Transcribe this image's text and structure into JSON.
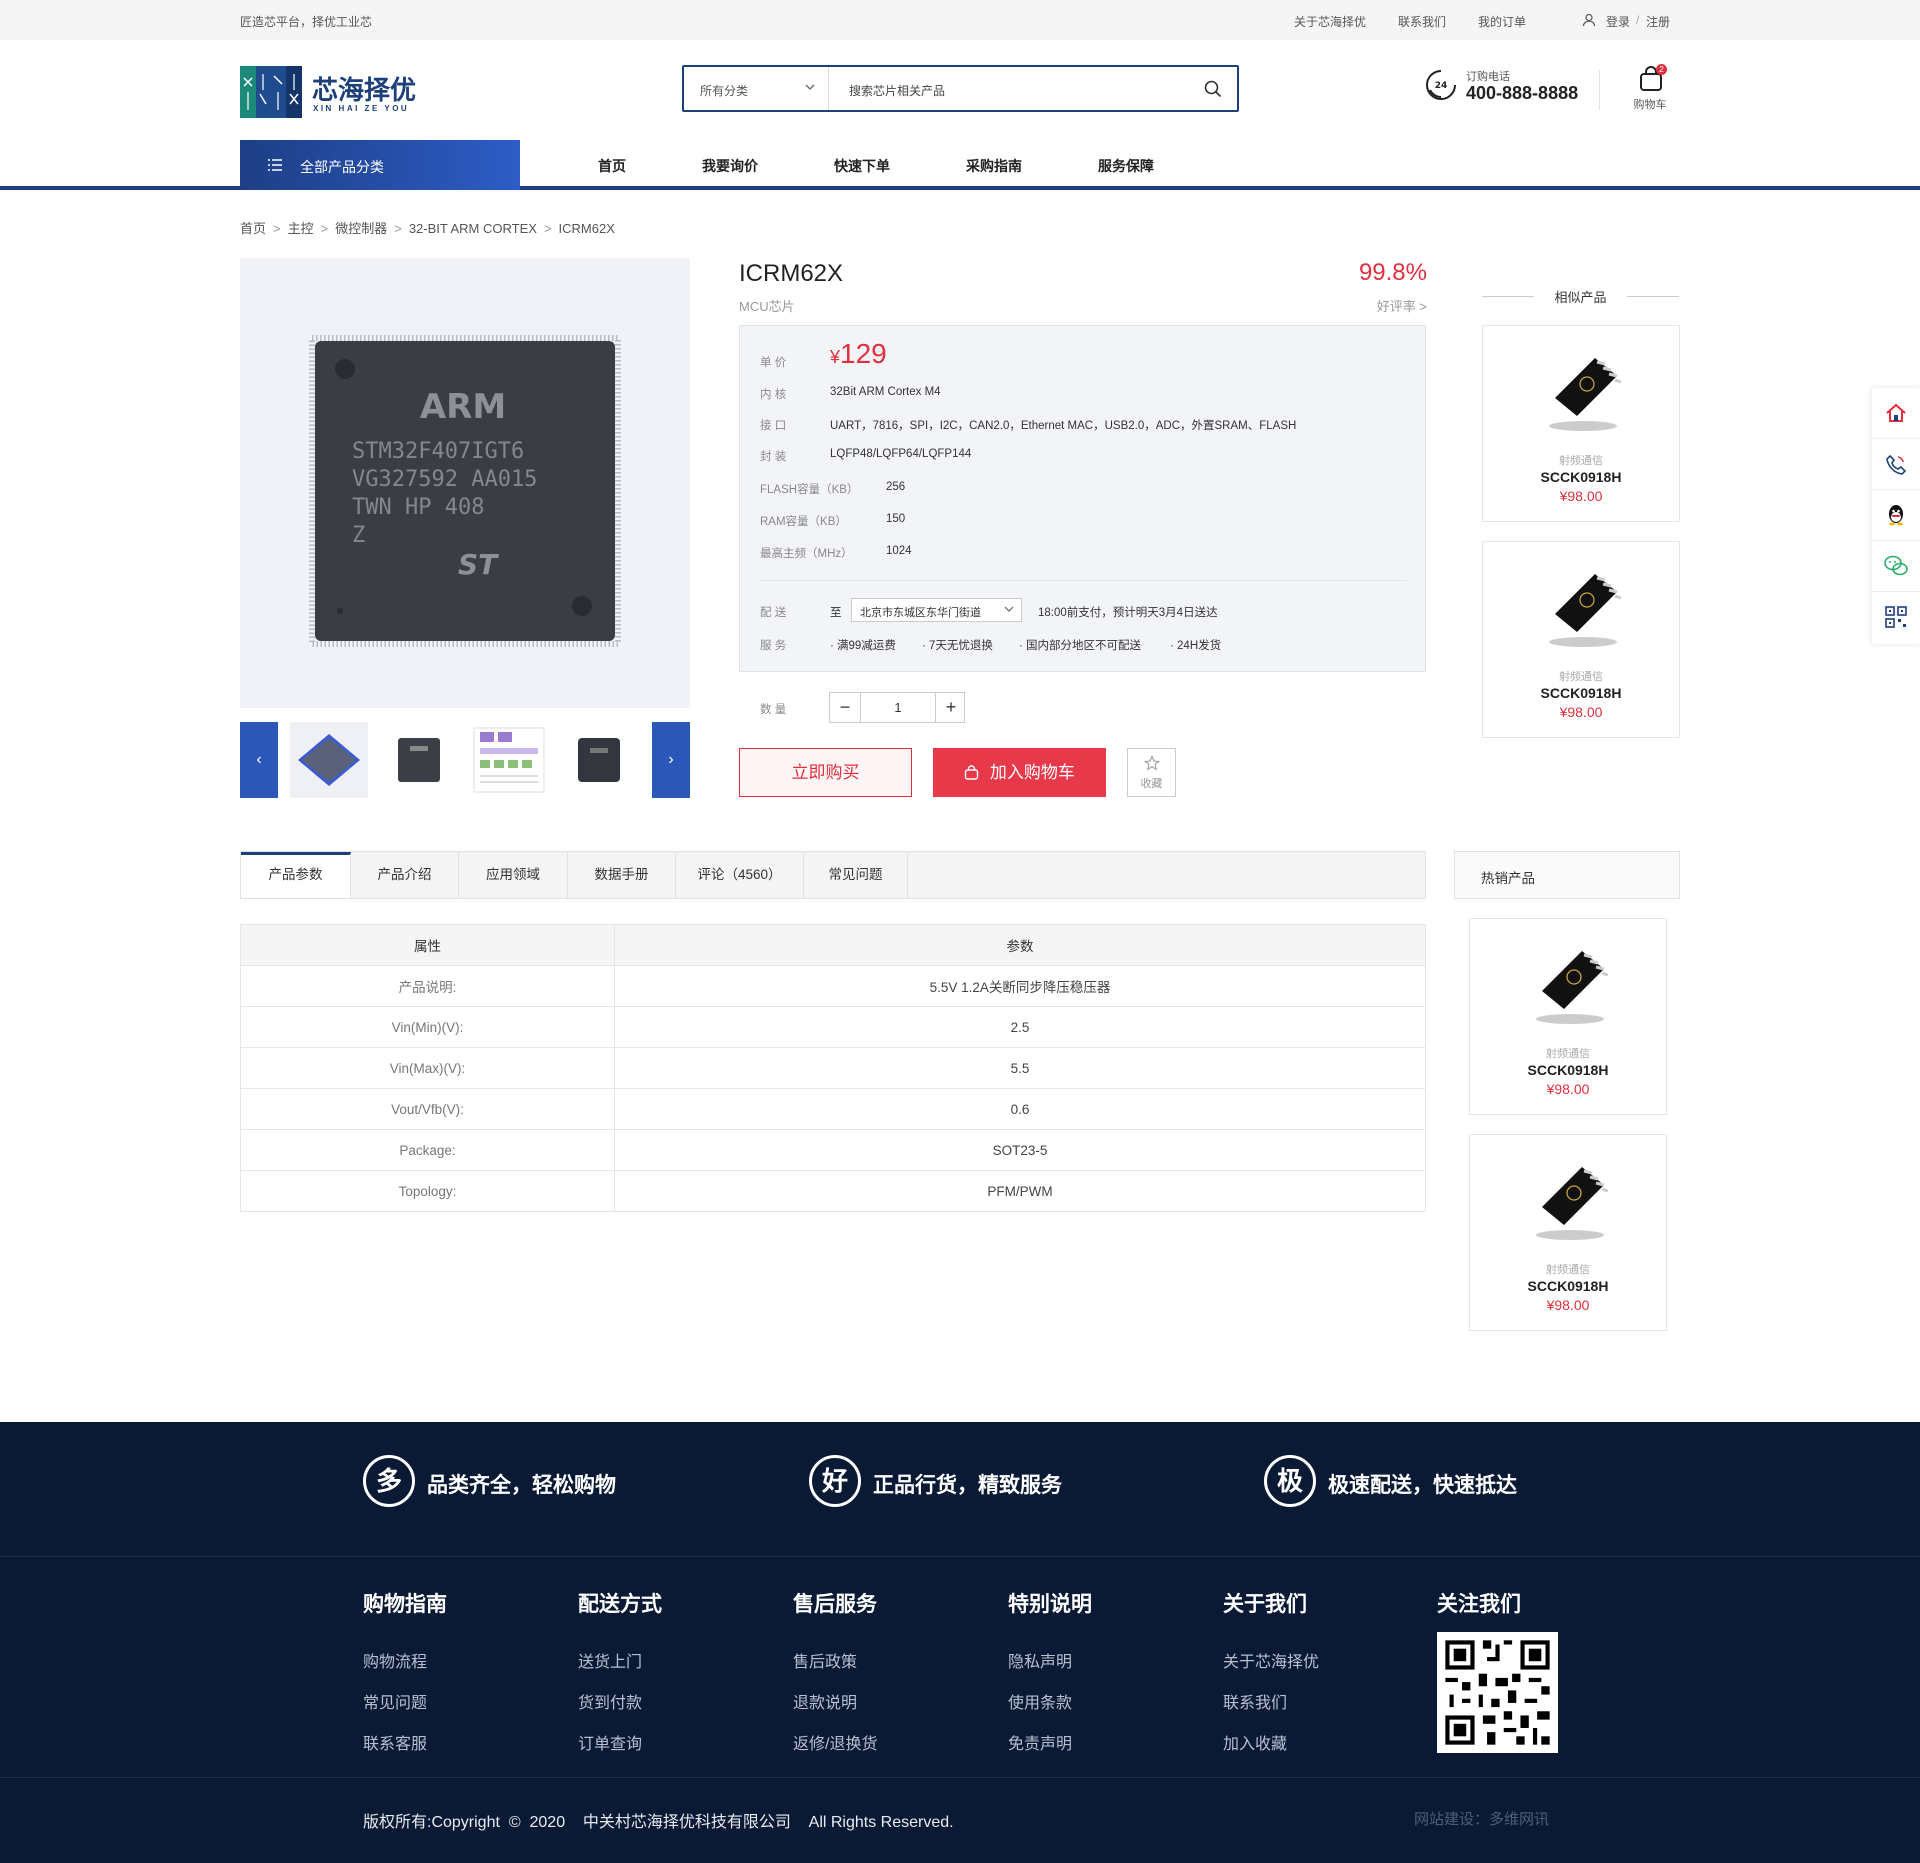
{
  "topbar": {
    "slogan": "匠造芯平台，择优工业芯",
    "links": [
      "关于芯海择优",
      "联系我们",
      "我的订单"
    ],
    "login": "登录",
    "sep": "/",
    "register": "注册"
  },
  "header": {
    "logo_cn": "芯海择优",
    "logo_en": "XIN HAI ZE YOU",
    "search_category": "所有分类",
    "search_placeholder": "搜索芯片相关产品",
    "phone_label": "订购电话",
    "phone_number": "400-888-8888",
    "phone_badge": "24",
    "cart_label": "购物车",
    "cart_count": "2"
  },
  "nav": {
    "all_categories": "全部产品分类",
    "items": [
      "首页",
      "我要询价",
      "快速下单",
      "采购指南",
      "服务保障"
    ]
  },
  "breadcrumb": [
    "首页",
    "主控",
    "微控制器",
    "32-BIT ARM CORTEX",
    "ICRM62X"
  ],
  "breadcrumb_sep": ">",
  "chip_print": {
    "brand": "ARM",
    "line1": "STM32F407IGT6",
    "line2": "VG327592  AA015",
    "line3": "TWN HP 408",
    "line4": "Z",
    "mark": "ST"
  },
  "product": {
    "title": "ICRM62X",
    "subtitle": "MCU芯片",
    "rating": "99.8%",
    "rating_label": "好评率 >",
    "price_label": "单  价",
    "currency": "¥",
    "price": "129",
    "specs": [
      {
        "label": "内  核",
        "value": "32Bit ARM Cortex M4"
      },
      {
        "label": "接  口",
        "value": "UART，7816，SPI，I2C，CAN2.0，Ethernet MAC，USB2.0，ADC，外置SRAM、FLASH"
      },
      {
        "label": "封  装",
        "value": "LQFP48/LQFP64/LQFP144"
      },
      {
        "label": "FLASH容量（KB）",
        "value": "256"
      },
      {
        "label": "RAM容量（KB）",
        "value": "150"
      },
      {
        "label": "最高主频（MHz）",
        "value": "1024"
      }
    ],
    "delivery_label": "配  送",
    "delivery_to": "至",
    "delivery_address": "北京市东城区东华门街道",
    "delivery_note": "18:00前支付，预计明天3月4日送达",
    "service_label": "服  务",
    "services": [
      "满99减运费",
      "7天无忧退换",
      "国内部分地区不可配送",
      "24H发货"
    ],
    "qty_label": "数  量",
    "qty_minus": "−",
    "qty_value": "1",
    "qty_plus": "+",
    "buy_now": "立即购买",
    "add_cart": "加入购物车",
    "favorite": "收藏"
  },
  "similar": {
    "title": "相似产品",
    "items": [
      {
        "category": "射频通信",
        "name": "SCCK0918H",
        "price": "¥98.00"
      },
      {
        "category": "射频通信",
        "name": "SCCK0918H",
        "price": "¥98.00"
      }
    ]
  },
  "tabs": [
    "产品参数",
    "产品介绍",
    "应用领域",
    "数据手册",
    "评论（4560）",
    "常见问题"
  ],
  "param_table": {
    "headers": [
      "属性",
      "参数"
    ],
    "rows": [
      [
        "产品说明:",
        "5.5V 1.2A关断同步降压稳压器"
      ],
      [
        "Vin(Min)(V):",
        "2.5"
      ],
      [
        "Vin(Max)(V):",
        "5.5"
      ],
      [
        "Vout/Vfb(V):",
        "0.6"
      ],
      [
        "Package:",
        "SOT23-5"
      ],
      [
        "Topology:",
        "PFM/PWM"
      ]
    ]
  },
  "hot": {
    "title": "热销产品",
    "items": [
      {
        "category": "射频通信",
        "name": "SCCK0918H",
        "price": "¥98.00"
      },
      {
        "category": "射频通信",
        "name": "SCCK0918H",
        "price": "¥98.00"
      }
    ]
  },
  "footer": {
    "features": [
      {
        "glyph": "多",
        "text": "品类齐全，轻松购物"
      },
      {
        "glyph": "好",
        "text": "正品行货，精致服务"
      },
      {
        "glyph": "极",
        "text": "极速配送，快速抵达"
      }
    ],
    "columns": [
      {
        "title": "购物指南",
        "items": [
          "购物流程",
          "常见问题",
          "联系客服"
        ]
      },
      {
        "title": "配送方式",
        "items": [
          "送货上门",
          "货到付款",
          "订单查询"
        ]
      },
      {
        "title": "售后服务",
        "items": [
          "售后政策",
          "退款说明",
          "返修/退换货"
        ]
      },
      {
        "title": "特别说明",
        "items": [
          "隐私声明",
          "使用条款",
          "免责声明"
        ]
      },
      {
        "title": "关于我们",
        "items": [
          "关于芯海择优",
          "联系我们",
          "加入收藏"
        ]
      }
    ],
    "follow_title": "关注我们",
    "copyright": "版权所有:Copyright  ©  2020    中关村芯海择优科技有限公司    All Rights Reserved.",
    "credit": "网站建设：多维网讯"
  },
  "colors": {
    "brand": "#1d3f7a",
    "accent": "#e0303f",
    "footer_bg": "#0a1a35"
  }
}
